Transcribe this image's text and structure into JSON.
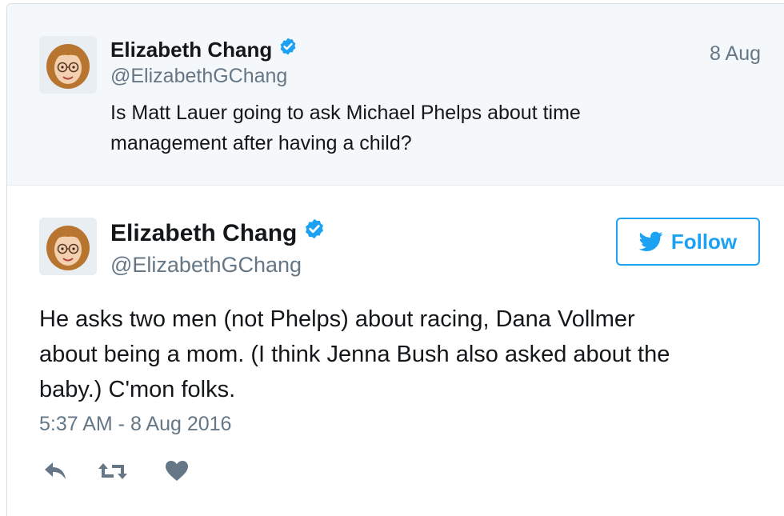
{
  "parent_tweet": {
    "author_name": "Elizabeth Chang",
    "handle": "@ElizabethGChang",
    "date": "8 Aug",
    "text_lines": [
      "Is Matt Lauer going to ask Michael Phelps about time",
      "management after having a child?"
    ]
  },
  "main_tweet": {
    "author_name": "Elizabeth Chang",
    "handle": "@ElizabethGChang",
    "follow_label": "Follow",
    "text_lines": [
      "He asks two men (not Phelps) about racing, Dana Vollmer",
      "about being a mom. (I think Jenna Bush also asked about the",
      "baby.) C'mon folks."
    ],
    "timestamp": "5:37 AM - 8 Aug 2016"
  },
  "icons": {
    "verified": "verified-badge-icon",
    "follow": "twitter-bird-icon",
    "reply": "reply-icon",
    "retweet": "retweet-icon",
    "like": "heart-icon"
  },
  "colors": {
    "accent": "#1da1f2",
    "verified": "#1da1f2",
    "muted": "#657786",
    "action_icon": "#657786",
    "parent_background": "#f5f8fa"
  }
}
